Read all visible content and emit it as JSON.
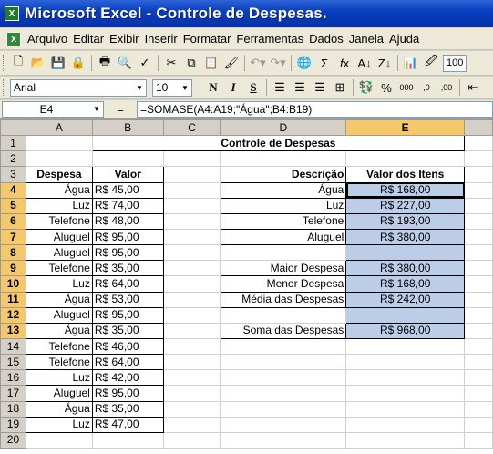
{
  "window": {
    "title": "Microsoft Excel - Controle de Despesas."
  },
  "menu": [
    "Arquivo",
    "Editar",
    "Exibir",
    "Inserir",
    "Formatar",
    "Ferramentas",
    "Dados",
    "Janela",
    "Ajuda"
  ],
  "toolbar": {
    "font": "Arial",
    "size": "10",
    "bold": "N",
    "italic": "I",
    "underline": "S",
    "zoom": "100"
  },
  "formula_bar": {
    "name_box": "E4",
    "equals": "=",
    "formula": "=SOMASE(A4:A19;\"Água\";B4:B19)"
  },
  "sheet": {
    "columns": [
      "A",
      "B",
      "C",
      "D",
      "E"
    ],
    "selected_column": "E",
    "title": "Controle de Despesas",
    "headers": {
      "despesa": "Despesa",
      "valor": "Valor",
      "descricao": "Descrição",
      "valor_itens": "Valor dos Itens"
    },
    "expenses": [
      {
        "row": "4",
        "name": "Água",
        "value": "R$ 45,00"
      },
      {
        "row": "5",
        "name": "Luz",
        "value": "R$ 74,00"
      },
      {
        "row": "6",
        "name": "Telefone",
        "value": "R$ 48,00"
      },
      {
        "row": "7",
        "name": "Aluguel",
        "value": "R$ 95,00"
      },
      {
        "row": "8",
        "name": "Aluguel",
        "value": "R$ 95,00"
      },
      {
        "row": "9",
        "name": "Telefone",
        "value": "R$ 35,00"
      },
      {
        "row": "10",
        "name": "Luz",
        "value": "R$ 64,00"
      },
      {
        "row": "11",
        "name": "Água",
        "value": "R$ 53,00"
      },
      {
        "row": "12",
        "name": "Aluguel",
        "value": "R$ 95,00"
      },
      {
        "row": "13",
        "name": "Água",
        "value": "R$ 35,00"
      },
      {
        "row": "14",
        "name": "Telefone",
        "value": "R$ 46,00"
      },
      {
        "row": "15",
        "name": "Telefone",
        "value": "R$ 64,00"
      },
      {
        "row": "16",
        "name": "Luz",
        "value": "R$ 42,00"
      },
      {
        "row": "17",
        "name": "Aluguel",
        "value": "R$ 95,00"
      },
      {
        "row": "18",
        "name": "Água",
        "value": "R$ 35,00"
      },
      {
        "row": "19",
        "name": "Luz",
        "value": "R$ 47,00"
      }
    ],
    "summary": [
      {
        "label": "Água",
        "value": "R$ 168,00"
      },
      {
        "label": "Luz",
        "value": "R$ 227,00"
      },
      {
        "label": "Telefone",
        "value": "R$ 193,00"
      },
      {
        "label": "Aluguel",
        "value": "R$ 380,00"
      },
      {
        "label": "",
        "value": ""
      },
      {
        "label": "Maior Despesa",
        "value": "R$ 380,00"
      },
      {
        "label": "Menor Despesa",
        "value": "R$ 168,00"
      },
      {
        "label": "Média das Despesas",
        "value": "R$ 242,00"
      },
      {
        "label": "",
        "value": ""
      },
      {
        "label": "Soma das Despesas",
        "value": "R$ 968,00"
      }
    ],
    "row_numbers": [
      "1",
      "2",
      "3",
      "4",
      "5",
      "6",
      "7",
      "8",
      "9",
      "10",
      "11",
      "12",
      "13",
      "14",
      "15",
      "16",
      "17",
      "18",
      "19",
      "20"
    ]
  }
}
